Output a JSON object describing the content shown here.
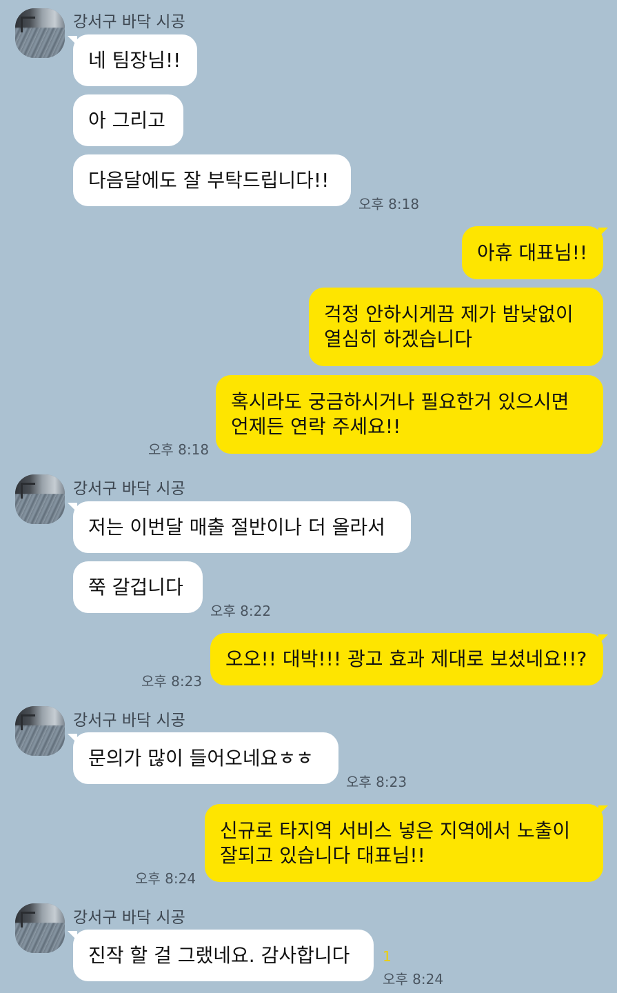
{
  "sender": "강서구 바닥 시공",
  "read_count": "1",
  "avatar_icon": "profile-photo-floor",
  "colors": {
    "background": "#abc1d1",
    "incoming": "#ffffff",
    "outgoing": "#fee500"
  },
  "messages": [
    {
      "dir": "in",
      "lines": [
        "네 팀장님!!"
      ]
    },
    {
      "dir": "in",
      "lines": [
        "아 그리고"
      ]
    },
    {
      "dir": "in",
      "lines": [
        "다음달에도 잘 부탁드립니다!!"
      ],
      "time": "오후 8:18"
    },
    {
      "dir": "out",
      "lines": [
        "아휴 대표님!!"
      ]
    },
    {
      "dir": "out",
      "lines": [
        "걱정 안하시게끔 제가 밤낮없이",
        "열심히 하겠습니다"
      ]
    },
    {
      "dir": "out",
      "lines": [
        "혹시라도 궁금하시거나 필요한거 있으시면",
        "언제든 연락 주세요!!"
      ],
      "time": "오후 8:18"
    },
    {
      "dir": "in",
      "lines": [
        "저는 이번달 매출 절반이나 더 올라서"
      ]
    },
    {
      "dir": "in",
      "lines": [
        "쭉 갈겁니다"
      ],
      "time": "오후 8:22"
    },
    {
      "dir": "out",
      "lines": [
        "오오!! 대박!!! 광고 효과 제대로 보셨네요!!?"
      ],
      "time": "오후 8:23"
    },
    {
      "dir": "in",
      "lines": [
        "문의가 많이 들어오네요ㅎㅎ"
      ],
      "time": "오후 8:23"
    },
    {
      "dir": "out",
      "lines": [
        "신규로 타지역 서비스 넣은 지역에서 노출이",
        "잘되고 있습니다 대표님!!"
      ],
      "time": "오후 8:24"
    },
    {
      "dir": "in",
      "lines": [
        "진작 할 걸 그랬네요. 감사합니다"
      ],
      "time": "오후 8:24"
    }
  ]
}
